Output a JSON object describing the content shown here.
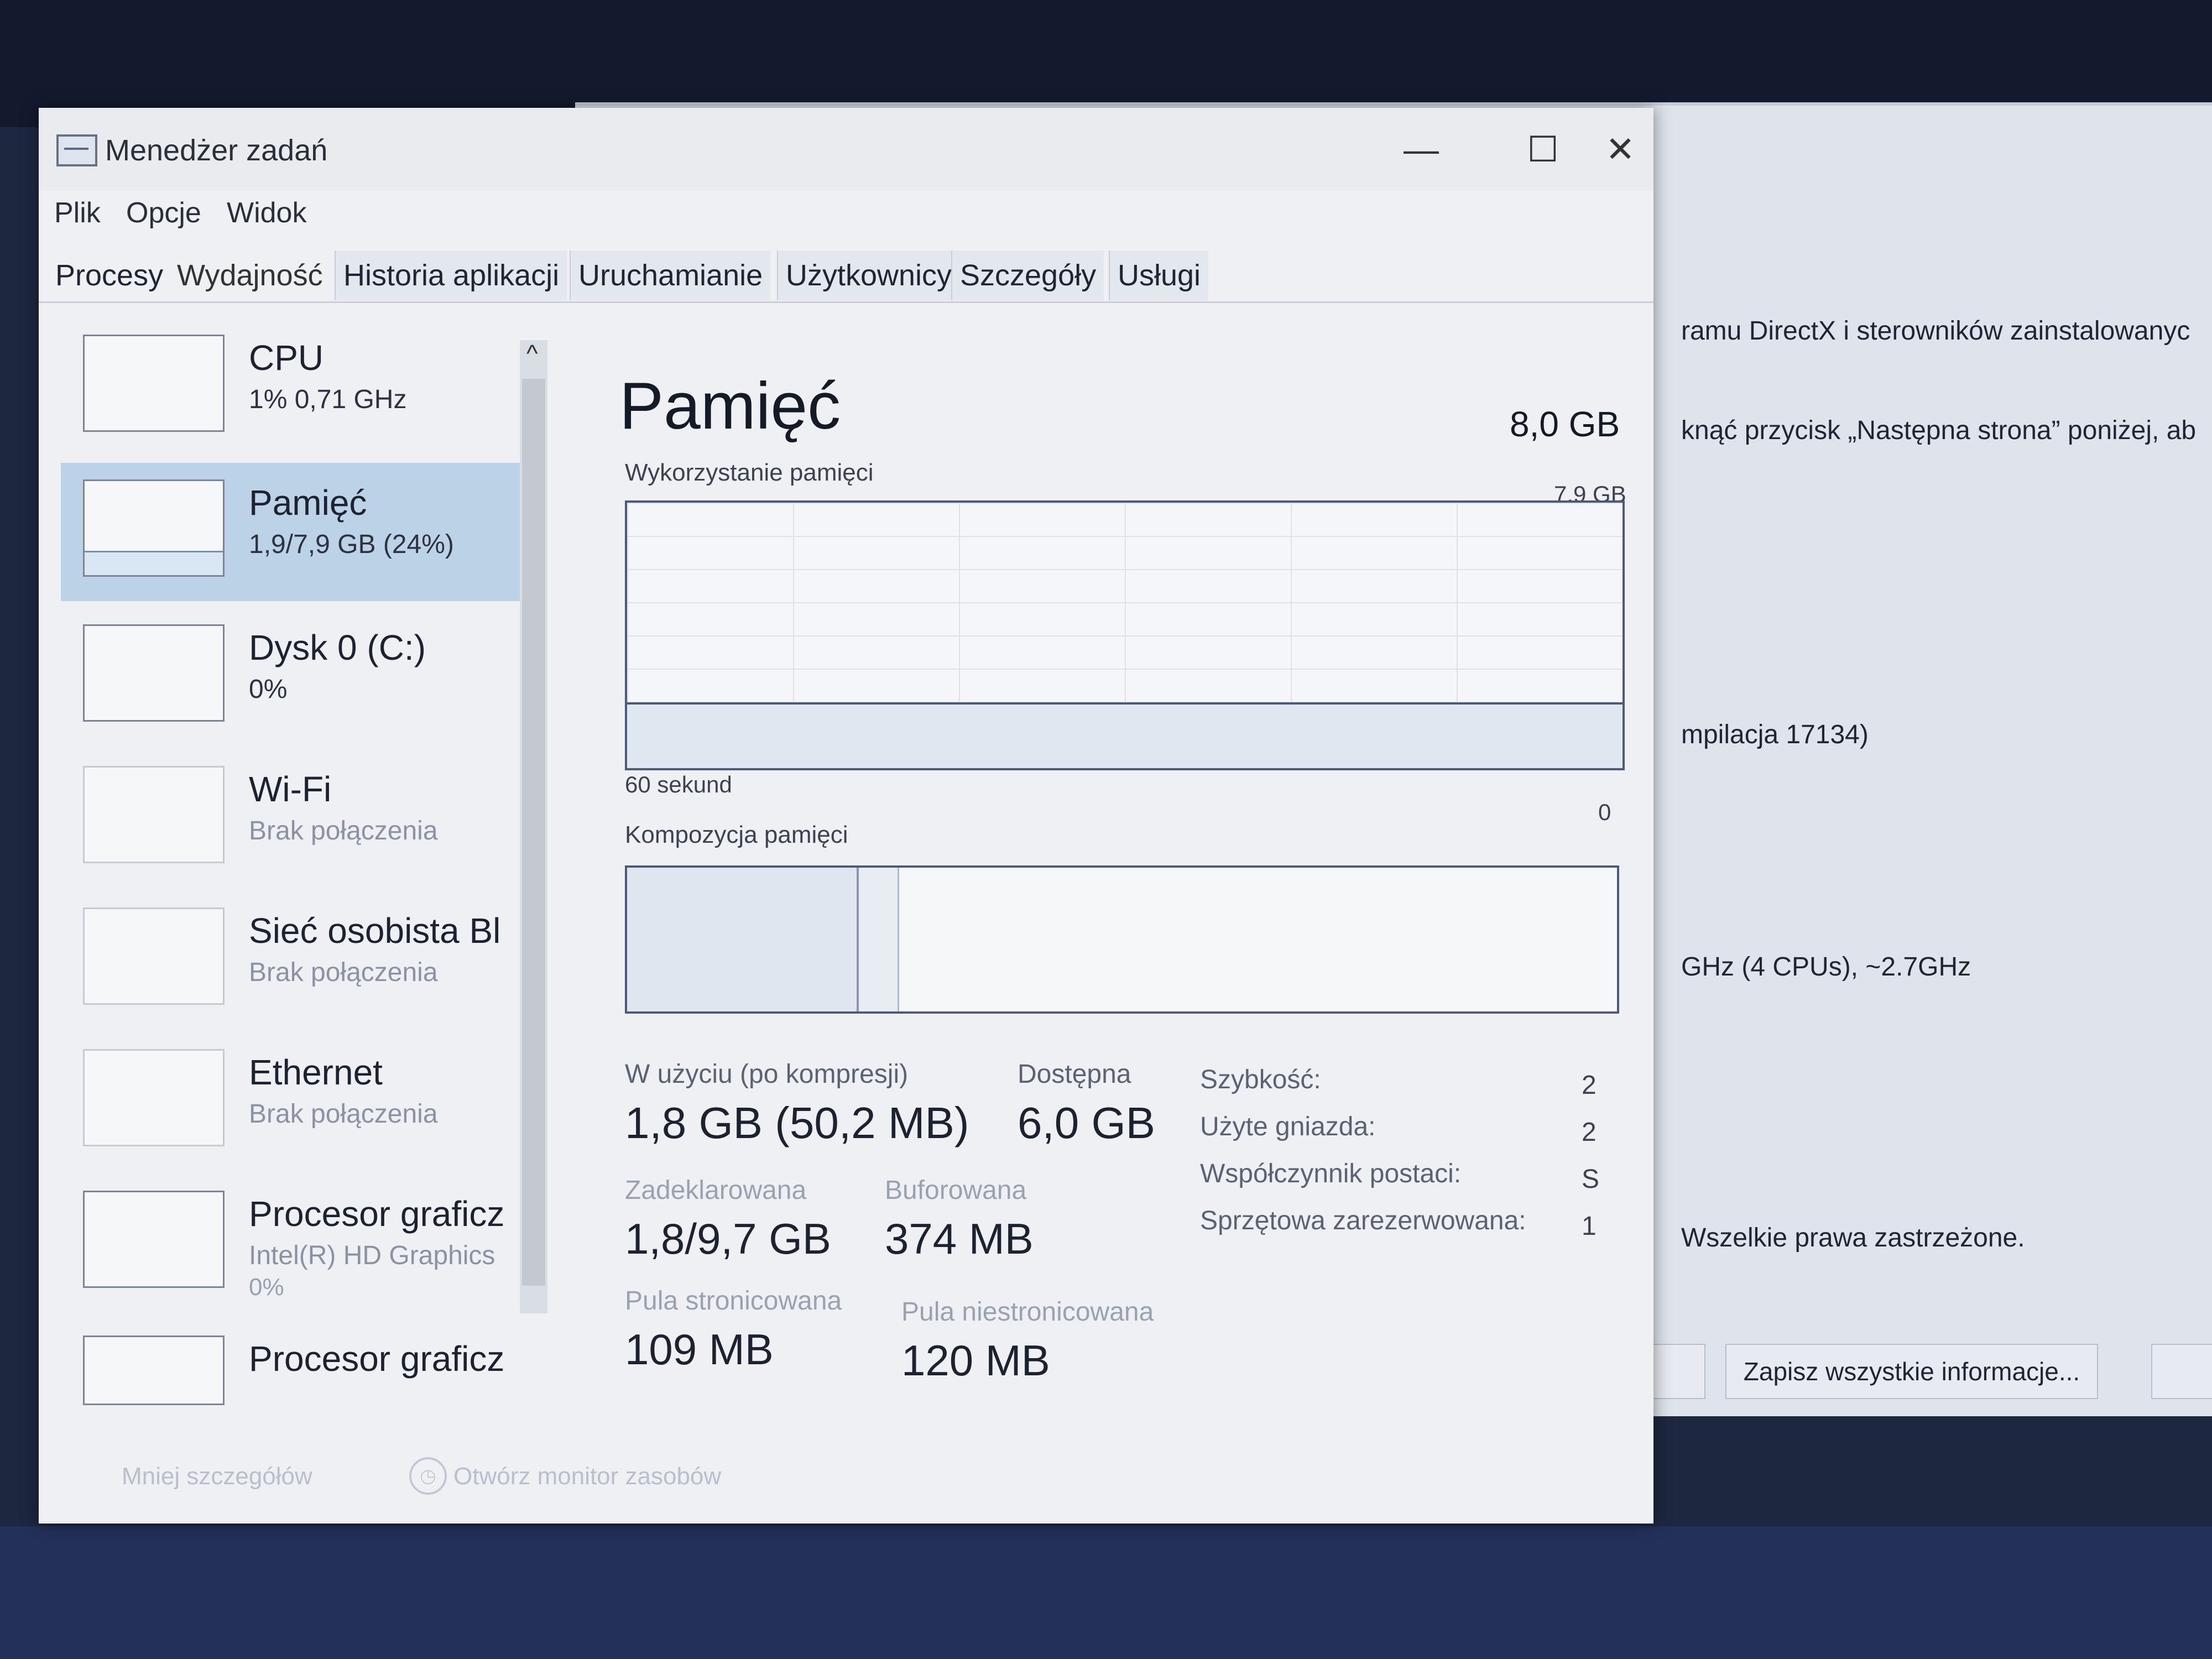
{
  "window": {
    "title": "Menedżer zadań",
    "controls": {
      "minimize": "—",
      "maximize": "☐",
      "close": "✕"
    }
  },
  "menu": [
    "Plik",
    "Opcje",
    "Widok"
  ],
  "tabs": [
    "Procesy",
    "Wydajność",
    "Historia aplikacji",
    "Uruchamianie",
    "Użytkownicy",
    "Szczegóły",
    "Usługi"
  ],
  "active_tab": "Wydajność",
  "sidebar": {
    "items": [
      {
        "title": "CPU",
        "sub": "1% 0,71 GHz",
        "sub2": ""
      },
      {
        "title": "Pamięć",
        "sub": "1,9/7,9 GB (24%)",
        "sub2": ""
      },
      {
        "title": "Dysk 0 (C:)",
        "sub": "0%",
        "sub2": ""
      },
      {
        "title": "Wi-Fi",
        "sub": "Brak połączenia",
        "sub2": ""
      },
      {
        "title": "Sieć osobista Bl",
        "sub": "Brak połączenia",
        "sub2": ""
      },
      {
        "title": "Ethernet",
        "sub": "Brak połączenia",
        "sub2": ""
      },
      {
        "title": "Procesor graficz",
        "sub": "Intel(R) HD Graphics",
        "sub2": "0%"
      },
      {
        "title": "Procesor graficz",
        "sub": "",
        "sub2": ""
      }
    ],
    "selected_index": 1,
    "memory_fill_fraction": 0.24,
    "scroll_up": "^"
  },
  "memory": {
    "title": "Pamięć",
    "total": "8,0 GB",
    "usage_label": "Wykorzystanie pamięci",
    "usage_max": "7,9 GB",
    "usage_fraction": 0.24,
    "axis_left": "60 sekund",
    "axis_right": "0",
    "composition_label": "Kompozycja pamięci",
    "stats": {
      "in_use_label": "W użyciu (po kompresji)",
      "in_use_value": "1,8 GB (50,2 MB)",
      "available_label": "Dostępna",
      "available_value": "6,0 GB",
      "committed_label": "Zadeklarowana",
      "committed_value": "1,8/9,7 GB",
      "cached_label": "Buforowana",
      "cached_value": "374 MB",
      "paged_label": "Pula stronicowana",
      "paged_value": "109 MB",
      "nonpaged_label": "Pula niestronicowana",
      "nonpaged_value": "120 MB"
    },
    "kv": [
      {
        "label": "Szybkość:",
        "value": "2"
      },
      {
        "label": "Użyte gniazda:",
        "value": "2"
      },
      {
        "label": "Współczynnik postaci:",
        "value": "S"
      },
      {
        "label": "Sprzętowa zarezerwowana:",
        "value": "1"
      }
    ]
  },
  "footer": {
    "less_details": "Mniej szczegółów",
    "resource_monitor": "Otwórz monitor zasobów"
  },
  "background_window": {
    "lines": [
      "ramu DirectX i sterowników zainstalowanyc",
      "knąć przycisk „Następna strona” poniżej, ab",
      "mpilacja 17134)",
      "GHz (4 CPUs), ~2.7GHz",
      "Wszelkie prawa zastrzeżone."
    ],
    "save_button": "Zapisz wszystkie informacje..."
  },
  "colors": {
    "selected_item": "#bcd2e6",
    "graph_border": "#4d5a78",
    "window_bg": "#eef0f4"
  }
}
